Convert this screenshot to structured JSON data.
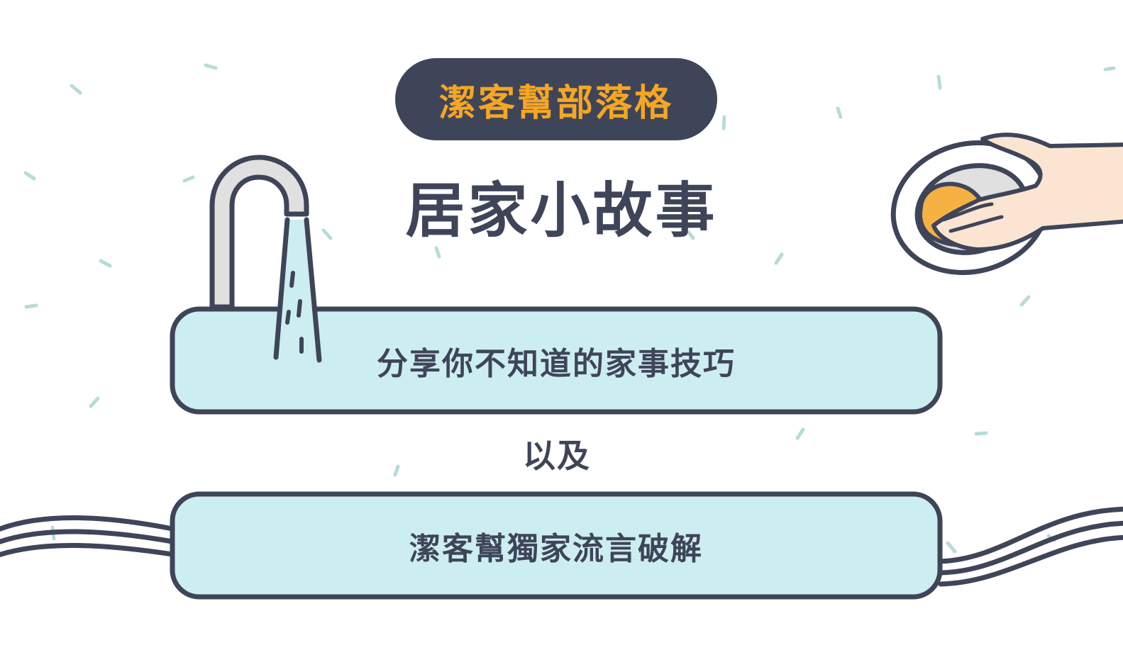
{
  "badge": {
    "label": "潔客幫部落格"
  },
  "title": "居家小故事",
  "boxes": [
    {
      "label": "分享你不知道的家事技巧"
    },
    {
      "label": "潔客幫獨家流言破解"
    }
  ],
  "connector": "以及",
  "icons": [
    "faucet-icon",
    "dish-washing-hand-icon",
    "water-pipes-icon"
  ],
  "colors": {
    "dark": "#3f4559",
    "accent": "#f5a623",
    "box_fill": "#cdeef0",
    "dash": "#b5dcd9"
  }
}
